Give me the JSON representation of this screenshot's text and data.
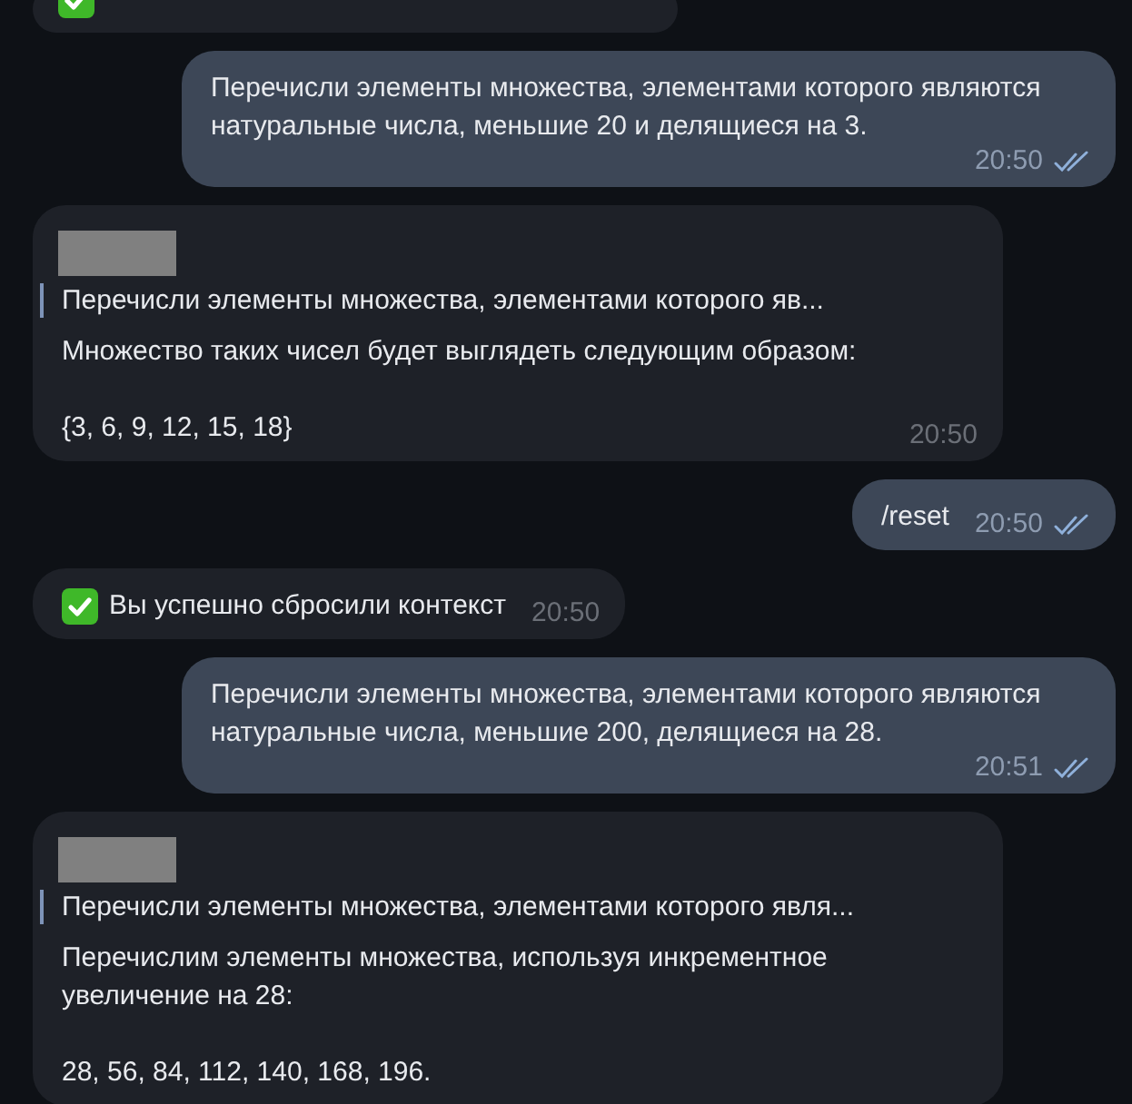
{
  "messages": [
    {
      "kind": "clipped"
    },
    {
      "kind": "outgoing",
      "paragraphs": [
        "Перечисли элементы множества, элементами которого являются натуральные числа, меньшие 20 и делящиеся на 3."
      ],
      "time": "20:50",
      "read": true
    },
    {
      "kind": "incoming",
      "sender_redacted": true,
      "quote": "Перечисли элементы множества, элементами которого яв...",
      "paragraphs": [
        "Множество таких чисел будет выглядеть следующим образом:",
        "{3, 6, 9, 12, 15, 18}"
      ],
      "time": "20:50"
    },
    {
      "kind": "outgoing",
      "paragraphs": [
        "/reset"
      ],
      "time": "20:50",
      "read": true
    },
    {
      "kind": "incoming",
      "check_emoji": true,
      "paragraphs": [
        "Вы успешно сбросили контекст"
      ],
      "time": "20:50"
    },
    {
      "kind": "outgoing",
      "paragraphs": [
        "Перечисли элементы множества, элементами которого являются натуральные числа, меньшие 200, делящиеся на 28."
      ],
      "time": "20:51",
      "read": true
    },
    {
      "kind": "incoming",
      "sender_redacted": true,
      "quote": "Перечисли элементы множества, элементами которого явля...",
      "paragraphs": [
        "Перечислим элементы множества, используя инкрементное увеличение на 28:",
        "28, 56, 84, 112, 140, 168, 196."
      ]
    }
  ]
}
